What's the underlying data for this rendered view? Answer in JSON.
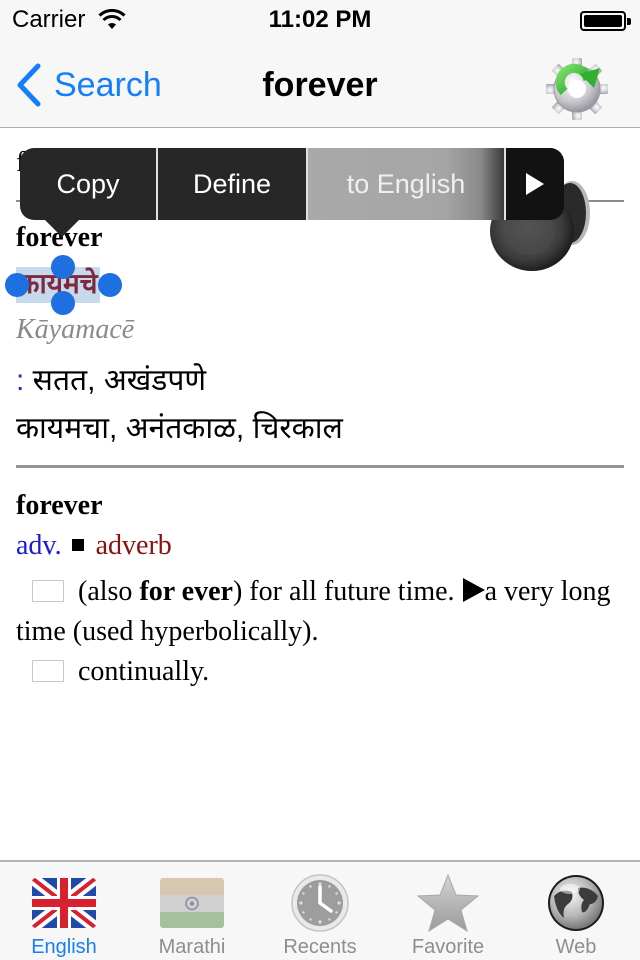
{
  "status_bar": {
    "carrier": "Carrier",
    "time": "11:02 PM",
    "battery_level": 1.0
  },
  "nav": {
    "back_label": "Search",
    "title": "forever",
    "right_icon": "gear-refresh-icon"
  },
  "content": {
    "hidden_first_line": "f",
    "entry1": {
      "headword": "forever",
      "marathi_selected": "कायमचे",
      "transliteration": "Kāyamacē",
      "synonyms_colon": ":",
      "synonyms_line1": " सतत, अखंडपणे",
      "synonyms_line2": "कायमचा, अनंतकाळ, चिरकाल"
    },
    "entry2": {
      "headword": "forever",
      "pos_abbr": "adv.",
      "pos_full": "adverb",
      "def1_open": "(also ",
      "def1_bold": "for ever",
      "def1_rest": ") for all future time.",
      "def1_sub": "a very long time (used hyperbolically).",
      "def2": "continually."
    }
  },
  "callout_menu": {
    "items": [
      "Copy",
      "Define",
      "to English"
    ],
    "highlighted": "to English",
    "more_icon": "play-right-icon"
  },
  "speaker_icon": "speaker-icon",
  "tab_bar": {
    "active": "English",
    "tabs": [
      {
        "label": "English",
        "icon": "uk-flag-icon"
      },
      {
        "label": "Marathi",
        "icon": "india-flag-icon"
      },
      {
        "label": "Recents",
        "icon": "clock-icon"
      },
      {
        "label": "Favorite",
        "icon": "star-icon"
      },
      {
        "label": "Web",
        "icon": "globe-icon"
      }
    ]
  },
  "colors": {
    "ios_blue": "#147efb",
    "selection_bg": "#c7d9ec",
    "handle_blue": "#1e6fe0",
    "marathi_word": "#7d2a3f",
    "pos_abbr": "#1a1ad6",
    "pos_full": "#8b1010"
  }
}
